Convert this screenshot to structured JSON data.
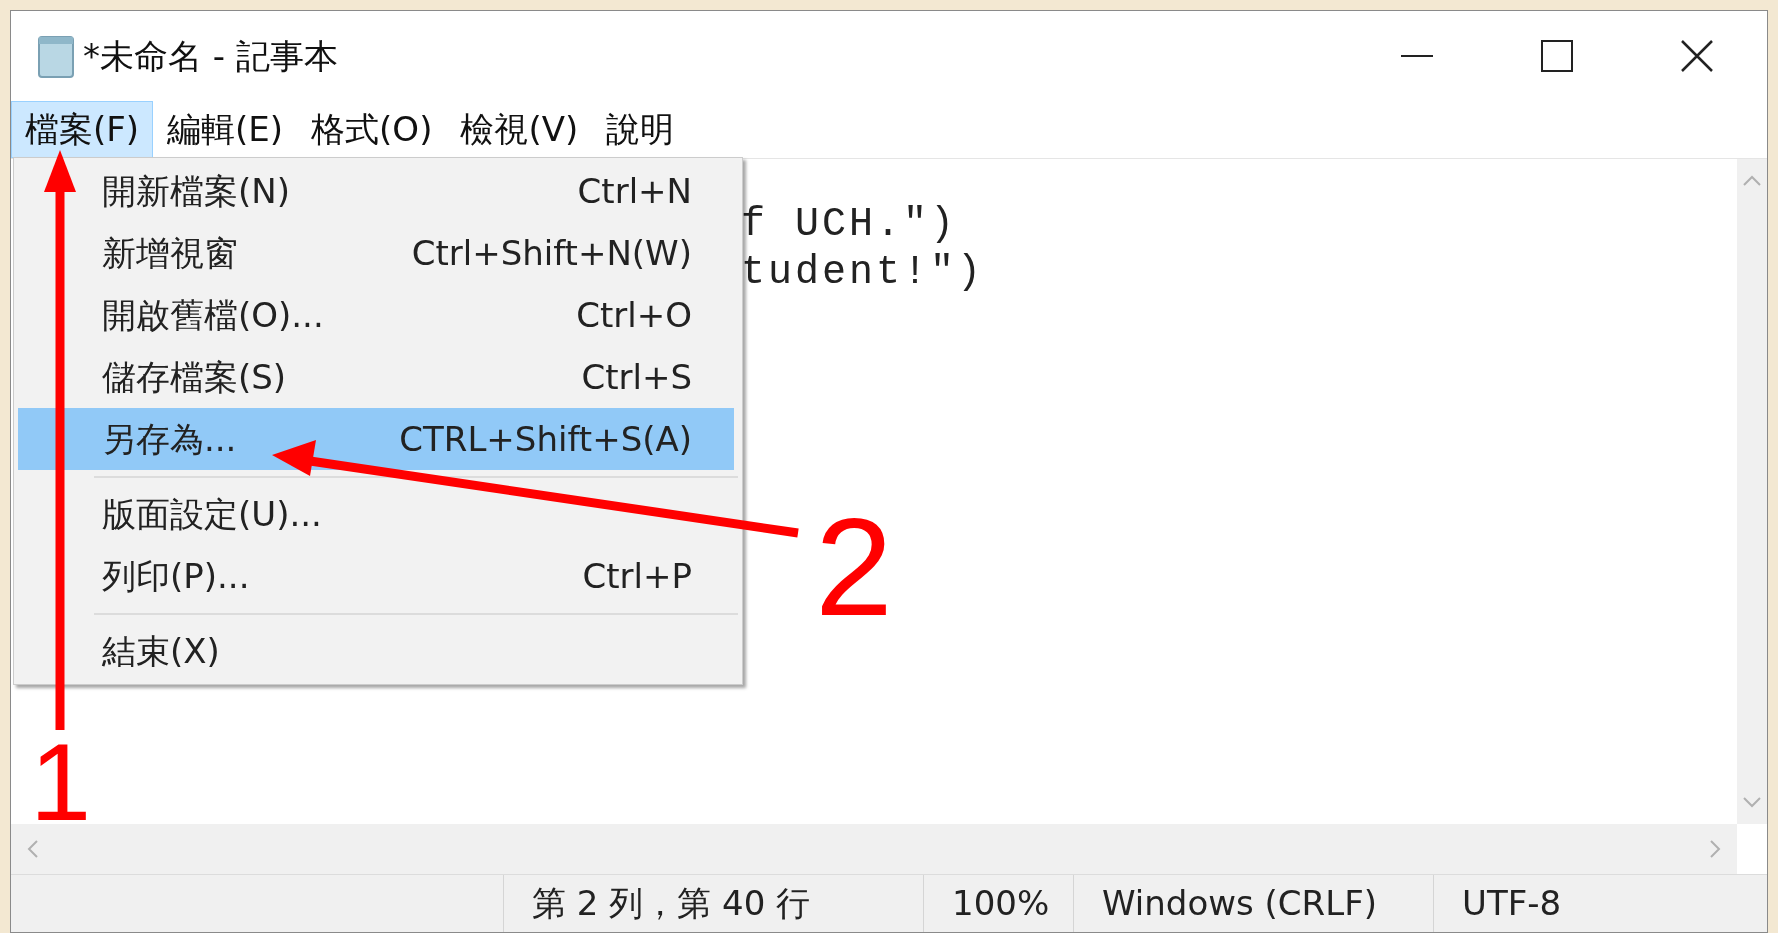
{
  "window": {
    "title": "*未命名 - 記事本"
  },
  "menu_bar": [
    {
      "label": "檔案(F)",
      "selected": true
    },
    {
      "label": "編輯(E)",
      "selected": false
    },
    {
      "label": "格式(O)",
      "selected": false
    },
    {
      "label": "檢視(V)",
      "selected": false
    },
    {
      "label": "說明",
      "selected": false
    }
  ],
  "file_menu": [
    {
      "kind": "item",
      "label": "開新檔案(N)",
      "shortcut": "Ctrl+N",
      "selected": false
    },
    {
      "kind": "item",
      "label": "新增視窗",
      "shortcut": "Ctrl+Shift+N(W)",
      "selected": false
    },
    {
      "kind": "item",
      "label": "開啟舊檔(O)...",
      "shortcut": "Ctrl+O",
      "selected": false
    },
    {
      "kind": "item",
      "label": "儲存檔案(S)",
      "shortcut": "Ctrl+S",
      "selected": false
    },
    {
      "kind": "item",
      "label": "另存為...",
      "shortcut": "CTRL+Shift+S(A)",
      "selected": true
    },
    {
      "kind": "separator"
    },
    {
      "kind": "item",
      "label": "版面設定(U)...",
      "selected": false
    },
    {
      "kind": "item",
      "label": "列印(P)...",
      "shortcut": "Ctrl+P",
      "selected": false
    },
    {
      "kind": "separator"
    },
    {
      "kind": "item",
      "label": "結束(X)",
      "selected": false
    }
  ],
  "editor": {
    "lines": [
      "f UCH.\")",
      "tudent!\")"
    ]
  },
  "status_bar": [
    "第 2 列，第 40 行",
    "100%",
    "Windows (CRLF)",
    "UTF-8"
  ],
  "annotations": [
    {
      "label": "1"
    },
    {
      "label": "2"
    }
  ]
}
